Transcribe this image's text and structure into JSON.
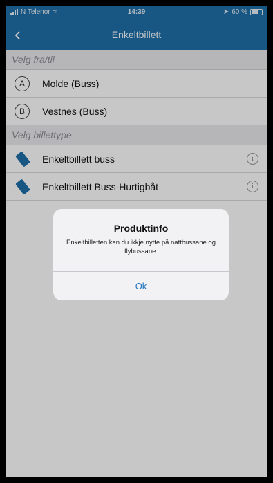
{
  "status_bar": {
    "carrier": "N Telenor",
    "time": "14:39",
    "battery": "60 %"
  },
  "nav": {
    "title": "Enkeltbillett"
  },
  "route_section": {
    "header": "Velg fra/til",
    "items": [
      {
        "marker": "A",
        "label": "Molde (Buss)"
      },
      {
        "marker": "B",
        "label": "Vestnes (Buss)"
      }
    ]
  },
  "ticket_section": {
    "header": "Velg billettype",
    "items": [
      {
        "label": "Enkeltbillett buss",
        "icon": "ticket-icon"
      },
      {
        "label": "Enkeltbillett Buss-Hurtigbåt",
        "icon": "ticket-icon"
      }
    ]
  },
  "alert": {
    "title": "Produktinfo",
    "message": "Enkeltbilletten kan du ikkje nytte på nattbussane og flybussane.",
    "ok_label": "Ok"
  },
  "colors": {
    "brand": "#1f6fa8",
    "link": "#1f74c0"
  }
}
